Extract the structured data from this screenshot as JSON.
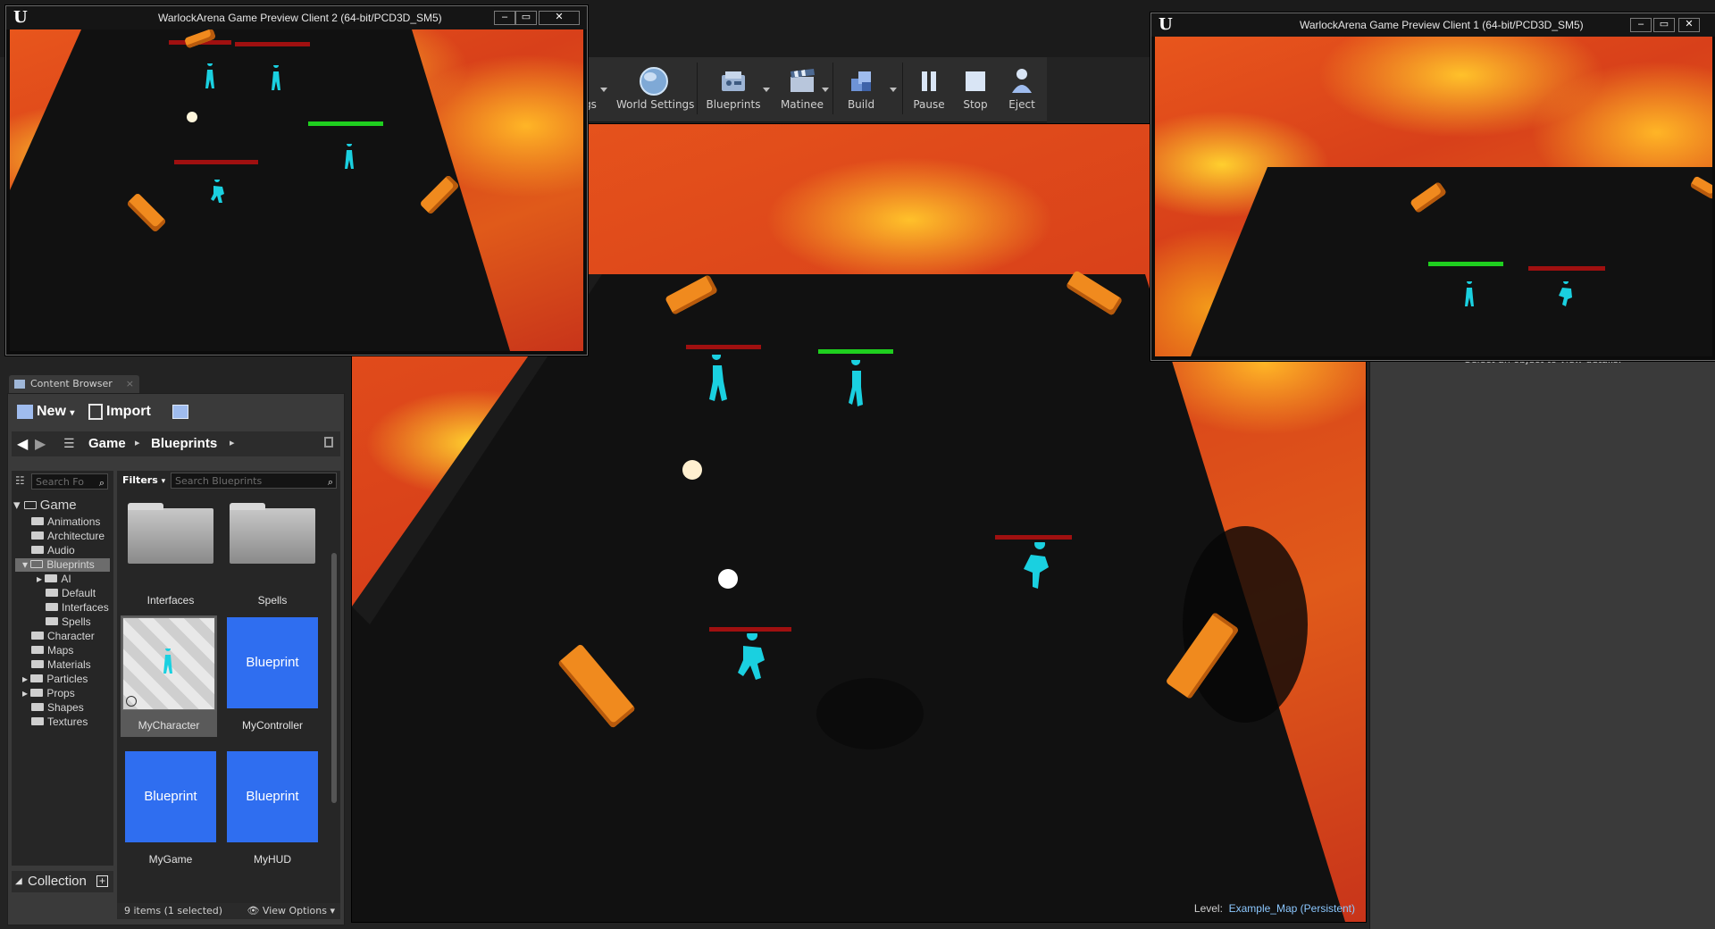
{
  "toolbar": {
    "partial_label": "gs",
    "items": [
      {
        "label": "World Settings",
        "icon": "globe-icon"
      },
      {
        "label": "Blueprints",
        "icon": "blueprints-icon"
      },
      {
        "label": "Matinee",
        "icon": "clapperboard-icon"
      },
      {
        "label": "Build",
        "icon": "build-blocks-icon"
      },
      {
        "label": "Pause",
        "icon": "pause-icon"
      },
      {
        "label": "Stop",
        "icon": "stop-icon"
      },
      {
        "label": "Eject",
        "icon": "eject-icon"
      }
    ]
  },
  "client2": {
    "title": "WarlockArena Game Preview Client 2 (64-bit/PCD3D_SM5)",
    "logo": "U",
    "buttons": [
      "–",
      "▭",
      "✕"
    ]
  },
  "client1": {
    "title": "WarlockArena Game Preview Client 1 (64-bit/PCD3D_SM5)",
    "logo": "U",
    "buttons": [
      "–",
      "▭",
      "✕"
    ]
  },
  "details": {
    "message": "Select an object to view details."
  },
  "viewport": {
    "level_prefix": "Level:",
    "level_name": "Example_Map (Persistent)"
  },
  "content_browser": {
    "tab_label": "Content Browser",
    "new_label": "New",
    "import_label": "Import",
    "breadcrumb": [
      "Game",
      "Blueprints"
    ],
    "folder_search_placeholder": "Search Fo",
    "filters_label": "Filters",
    "asset_search_placeholder": "Search Blueprints",
    "tree": [
      {
        "label": "Game",
        "level": 0,
        "expanded": true
      },
      {
        "label": "Animations",
        "level": 1
      },
      {
        "label": "Architecture",
        "level": 1
      },
      {
        "label": "Audio",
        "level": 1
      },
      {
        "label": "Blueprints",
        "level": 1,
        "selected": true,
        "expanded": true
      },
      {
        "label": "AI",
        "level": 2
      },
      {
        "label": "Default",
        "level": 2
      },
      {
        "label": "Interfaces",
        "level": 2
      },
      {
        "label": "Spells",
        "level": 2
      },
      {
        "label": "Character",
        "level": 1
      },
      {
        "label": "Maps",
        "level": 1
      },
      {
        "label": "Materials",
        "level": 1
      },
      {
        "label": "Particles",
        "level": 1
      },
      {
        "label": "Props",
        "level": 1
      },
      {
        "label": "Shapes",
        "level": 1
      },
      {
        "label": "Textures",
        "level": 1
      }
    ],
    "assets": [
      {
        "name": "Interfaces",
        "kind": "folder"
      },
      {
        "name": "Spells",
        "kind": "folder"
      },
      {
        "name": "MyCharacter",
        "kind": "character",
        "selected": true
      },
      {
        "name": "MyController",
        "kind": "blueprint",
        "thumb_label": "Blueprint"
      },
      {
        "name": "MyGame",
        "kind": "blueprint",
        "thumb_label": "Blueprint"
      },
      {
        "name": "MyHUD",
        "kind": "blueprint",
        "thumb_label": "Blueprint"
      }
    ],
    "collection_label": "Collection",
    "status": "9 items (1 selected)",
    "view_options_label": "View Options"
  },
  "colors": {
    "lava_orange": "#e0561a",
    "lava_yellow": "#ffc42a",
    "floor": "#111111",
    "player_cyan": "#1ad0e0",
    "health_red": "#a01010",
    "health_green": "#1fcf1f",
    "pillar_orange": "#f08a1e",
    "blueprint_blue": "#2f6ef0"
  }
}
